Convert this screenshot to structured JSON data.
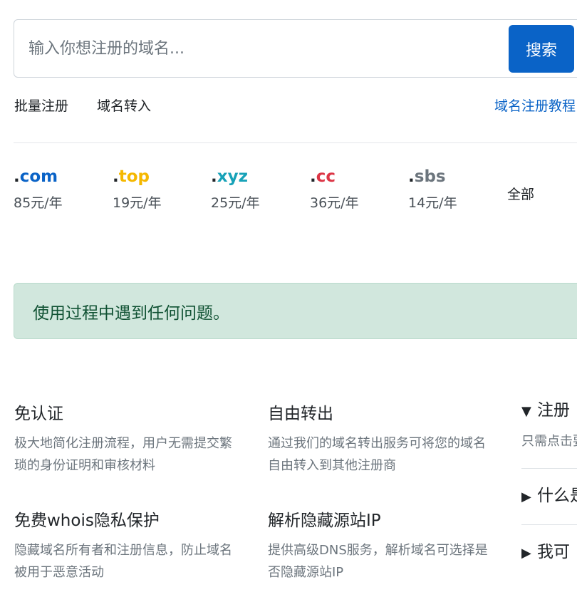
{
  "search": {
    "placeholder": "输入你想注册的域名...",
    "button_label": "搜索"
  },
  "links": {
    "bulk_register": "批量注册",
    "transfer_in": "域名转入",
    "tutorial": "域名注册教程"
  },
  "tlds": [
    {
      "dot": ".",
      "ext": "com",
      "price": "85元/年",
      "color": "#0a63c7"
    },
    {
      "dot": ".",
      "ext": "top",
      "price": "19元/年",
      "color": "#f5b800"
    },
    {
      "dot": ".",
      "ext": "xyz",
      "price": "25元/年",
      "color": "#17a2b8"
    },
    {
      "dot": ".",
      "ext": "cc",
      "price": "36元/年",
      "color": "#dc3545"
    },
    {
      "dot": ".",
      "ext": "sbs",
      "price": "14元/年",
      "color": "#6c757d"
    }
  ],
  "tld_all_label": "全部",
  "alert_text": "使用过程中遇到任何问题。",
  "features": [
    {
      "title": "免认证",
      "desc": "极大地简化注册流程，用户无需提交繁琐的身份证明和审核材料"
    },
    {
      "title": "自由转出",
      "desc": "通过我们的域名转出服务可将您的域名自由转入到其他注册商"
    },
    {
      "title": "免费whois隐私保护",
      "desc": "隐藏域名所有者和注册信息，防止域名被用于恶意活动"
    },
    {
      "title": "解析隐藏源站IP",
      "desc": "提供高级DNS服务，解析域名可选择是否隐藏源站IP"
    }
  ],
  "faq": {
    "open_arrow": "▼",
    "closed_arrow": "▶",
    "items": [
      {
        "summary": "注册",
        "answer": "只需点击要的域名往结帐，"
      },
      {
        "summary": "什么是",
        "answer": ""
      },
      {
        "summary": "我可",
        "answer": ""
      }
    ]
  }
}
